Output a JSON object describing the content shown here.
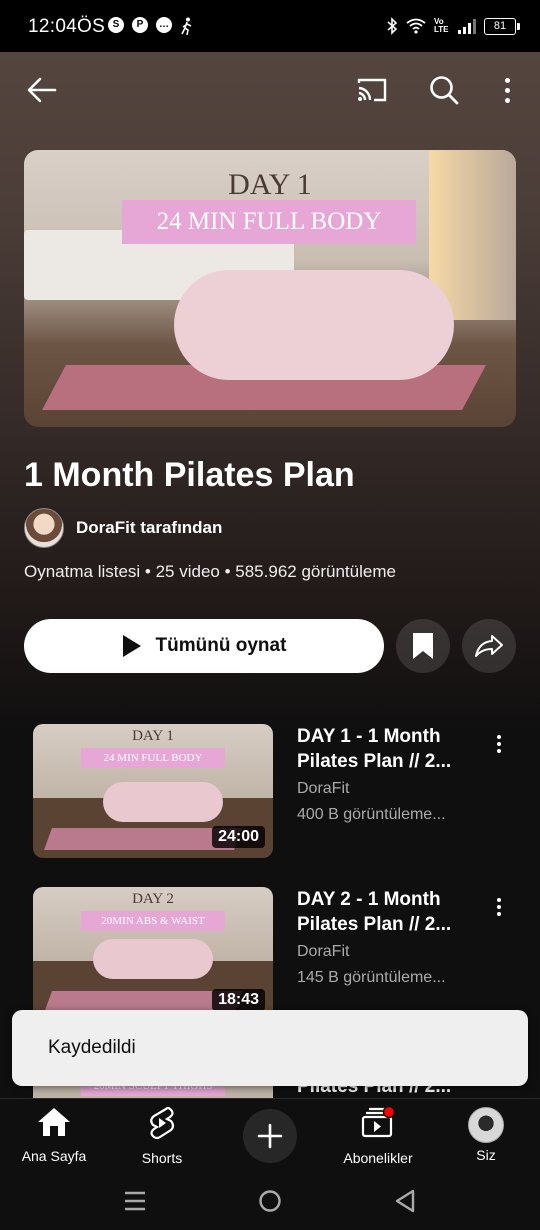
{
  "status_bar": {
    "time": "12:04ÖS",
    "network": "Vo LTE",
    "battery": "81"
  },
  "playlist": {
    "title": "1 Month Pilates Plan",
    "owner": "DoraFit tarafından",
    "meta": "Oynatma listesi • 25 video • 585.962 görüntüleme",
    "play_all_label": "Tümünü oynat",
    "hero": {
      "day": "DAY 1",
      "banner": "24 MIN FULL BODY"
    }
  },
  "videos": [
    {
      "title": "DAY 1 - 1 Month Pilates Plan // 2...",
      "channel": "DoraFit",
      "views": "400 B görüntüleme...",
      "duration": "24:00",
      "thumb_day": "DAY 1",
      "thumb_banner": "24 MIN FULL BODY"
    },
    {
      "title": "DAY 2 - 1 Month Pilates Plan // 2...",
      "channel": "DoraFit",
      "views": "145 B görüntüleme...",
      "duration": "18:43",
      "thumb_day": "DAY 2",
      "thumb_banner": "20MIN ABS & WAIST"
    },
    {
      "title": "Pilates Plan // 2...",
      "thumb_banner": "20MIN SCULPT THIGHS"
    }
  ],
  "toast": "Kaydedildi",
  "nav": {
    "home": "Ana Sayfa",
    "shorts": "Shorts",
    "subscriptions": "Abonelikler",
    "you": "Siz"
  },
  "colors": {
    "background": "#0f0f0f",
    "toast_bg": "#efefef",
    "notification_dot": "#ff0000",
    "banner_pink": "#e7a7d6"
  }
}
